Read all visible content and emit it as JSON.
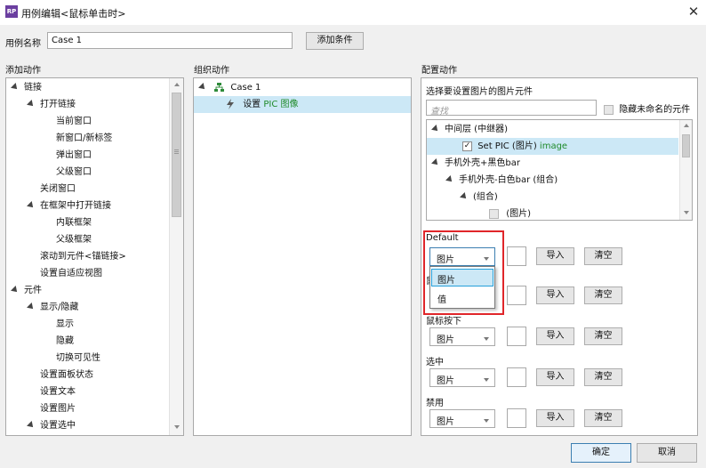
{
  "window": {
    "app_icon": "RP",
    "title": "用例编辑<鼠标单击时>",
    "close": "✕"
  },
  "case_name": {
    "label": "用例名称",
    "value": "Case 1",
    "add_condition": "添加条件"
  },
  "add_actions": {
    "header": "添加动作",
    "items": [
      "链接",
      "打开链接",
      "当前窗口",
      "新窗口/新标签",
      "弹出窗口",
      "父级窗口",
      "关闭窗口",
      "在框架中打开链接",
      "内联框架",
      "父级框架",
      "滚动到元件<锚链接>",
      "设置自适应视图",
      "元件",
      "显示/隐藏",
      "显示",
      "隐藏",
      "切换可见性",
      "设置面板状态",
      "设置文本",
      "设置图片",
      "设置选中"
    ]
  },
  "organize_actions": {
    "header": "组织动作",
    "case_label": "Case 1",
    "action_prefix": "设置",
    "action_target": "PIC 图像"
  },
  "config_actions": {
    "header": "配置动作",
    "select_label": "选择要设置图片的图片元件",
    "search_placeholder": "查找",
    "hide_unnamed": "隐藏未命名的元件",
    "tree": {
      "layer": "中间层 (中继器)",
      "set_pic_prefix": "Set PIC (图片)",
      "set_pic_suffix": "image",
      "phone_case": "手机外壳+黑色bar",
      "phone_case_white": "手机外壳-白色bar (组合)",
      "group": "(组合)",
      "image": "(图片)"
    },
    "states": [
      {
        "label": "Default",
        "type": "图片",
        "import": "导入",
        "clear": "清空"
      },
      {
        "label": "鼠",
        "type": "图片",
        "import": "导入",
        "clear": "清空"
      },
      {
        "label": "鼠标按下",
        "type": "图片",
        "import": "导入",
        "clear": "清空"
      },
      {
        "label": "选中",
        "type": "图片",
        "import": "导入",
        "clear": "清空"
      },
      {
        "label": "禁用",
        "type": "图片",
        "import": "导入",
        "clear": "清空"
      }
    ],
    "dropdown_options": [
      "图片",
      "值"
    ]
  },
  "footer": {
    "ok": "确定",
    "cancel": "取消"
  },
  "colors": {
    "highlight_border": "#e0262a",
    "selection": "#cce8f6",
    "green_text": "#1f8a2a",
    "ok_border": "#3c7fb1"
  }
}
